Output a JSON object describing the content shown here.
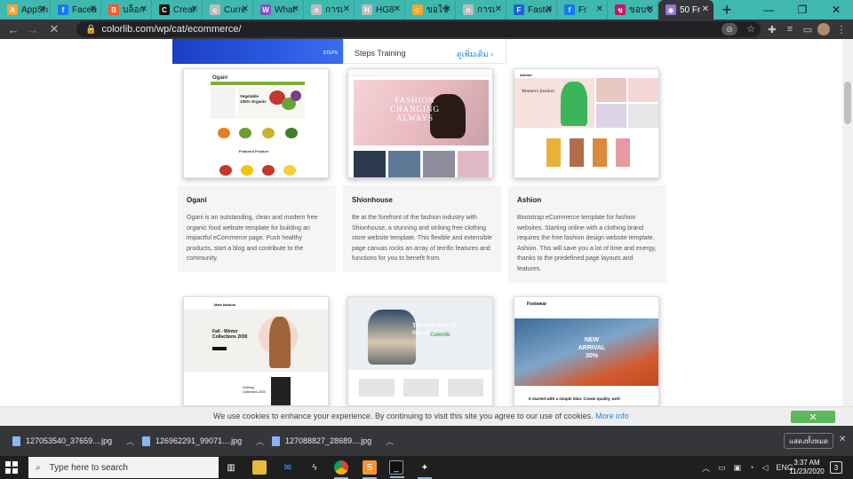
{
  "browser": {
    "tabs": [
      {
        "label": "AppSh",
        "favicon_color": "#f4a236",
        "glyph": "A"
      },
      {
        "label": "Faceb",
        "favicon_color": "#1877f2",
        "glyph": "f"
      },
      {
        "label": "บล็อก",
        "favicon_color": "#ff5722",
        "glyph": "B"
      },
      {
        "label": "Creat",
        "favicon_color": "#111111",
        "glyph": "C"
      },
      {
        "label": "Curre",
        "favicon_color": "#bdbdbd",
        "glyph": "c"
      },
      {
        "label": "What",
        "favicon_color": "#7e57c2",
        "glyph": "W"
      },
      {
        "label": "การเ",
        "favicon_color": "#bdbdbd",
        "glyph": "ก"
      },
      {
        "label": "HG8",
        "favicon_color": "#bdbdbd",
        "glyph": "H"
      },
      {
        "label": "ขอใช้",
        "favicon_color": "#f9a825",
        "glyph": "☺"
      },
      {
        "label": "การเ",
        "favicon_color": "#bdbdbd",
        "glyph": "ก"
      },
      {
        "label": "Fastw",
        "favicon_color": "#1e63d6",
        "glyph": "F"
      },
      {
        "label": "Fr",
        "favicon_color": "#1877f2",
        "glyph": "f"
      },
      {
        "label": "ขอบข",
        "favicon_color": "#c2185b",
        "glyph": "ข"
      },
      {
        "label": "50 Fr",
        "favicon_color": "#9575cd",
        "glyph": "◉"
      }
    ],
    "url": "colorlib.com/wp/cat/ecommerce/",
    "new_tab": "+",
    "window_controls": [
      "—",
      "❐",
      "✕"
    ]
  },
  "page": {
    "banner": {
      "title": "Steps Training",
      "more": "ดูเพิ่มเติม",
      "logo": "STEPS"
    },
    "cards": [
      {
        "name": "Ogani",
        "description": "Ogani is an outstanding, clean and modern free organic food website template for building an impactful eCommerce page. Push healthy products, start a blog and contribute to the community.",
        "thumb_heading": "Vegetable 100% Organic",
        "thumb_sub": "Featured Product",
        "thumb_logo": "Ogani"
      },
      {
        "name": "Shionhouse",
        "description": "Be at the forefront of the fashion industry with Shionhouse, a stunning and striking free clothing store website template. This flexible and extensible page canvas rocks an array of terrific features and functions for you to benefit from.",
        "thumb_heading": "FASHION CHANGING ALWAYS"
      },
      {
        "name": "Ashion",
        "description": "Bootstrap eCommerce template for fashion websites. Starting online with a clothing brand requires the free fashion design website template. Ashion. This will save you a lot of time and energy, thanks to the predefined page layouts and features.",
        "thumb_heading": "Women's fashion",
        "thumb_logo": "Ashion"
      }
    ],
    "cards_row2": [
      {
        "thumb_heading": "Fall - Winter Collections 2030",
        "thumb_sub": "Clothing Collections 2030",
        "thumb_logo": "Male fashion"
      },
      {
        "thumb_heading": "The New Way To Success",
        "thumb_logo": "Colorlib"
      },
      {
        "thumb_heading": "NEW ARRIVAL 30%",
        "thumb_sub": "It started with a simple idea: Create quality, well-",
        "thumb_logo": "Footwear"
      }
    ]
  },
  "cookie_bar": {
    "message": "We use cookies to enhance your experience. By continuing to visit this site you agree to our use of cookies.",
    "more": "More info",
    "ok": "✕"
  },
  "downloads": {
    "files": [
      "127053540_37659....jpg",
      "126962291_99071....jpg",
      "127088827_28689....jpg"
    ],
    "show_all": "แสดงทั้งหมด",
    "close": "✕"
  },
  "taskbar": {
    "search_placeholder": "Type here to search",
    "language": "ENG",
    "time": "3:37 AM",
    "date": "11/23/2020",
    "notification_count": "3"
  }
}
